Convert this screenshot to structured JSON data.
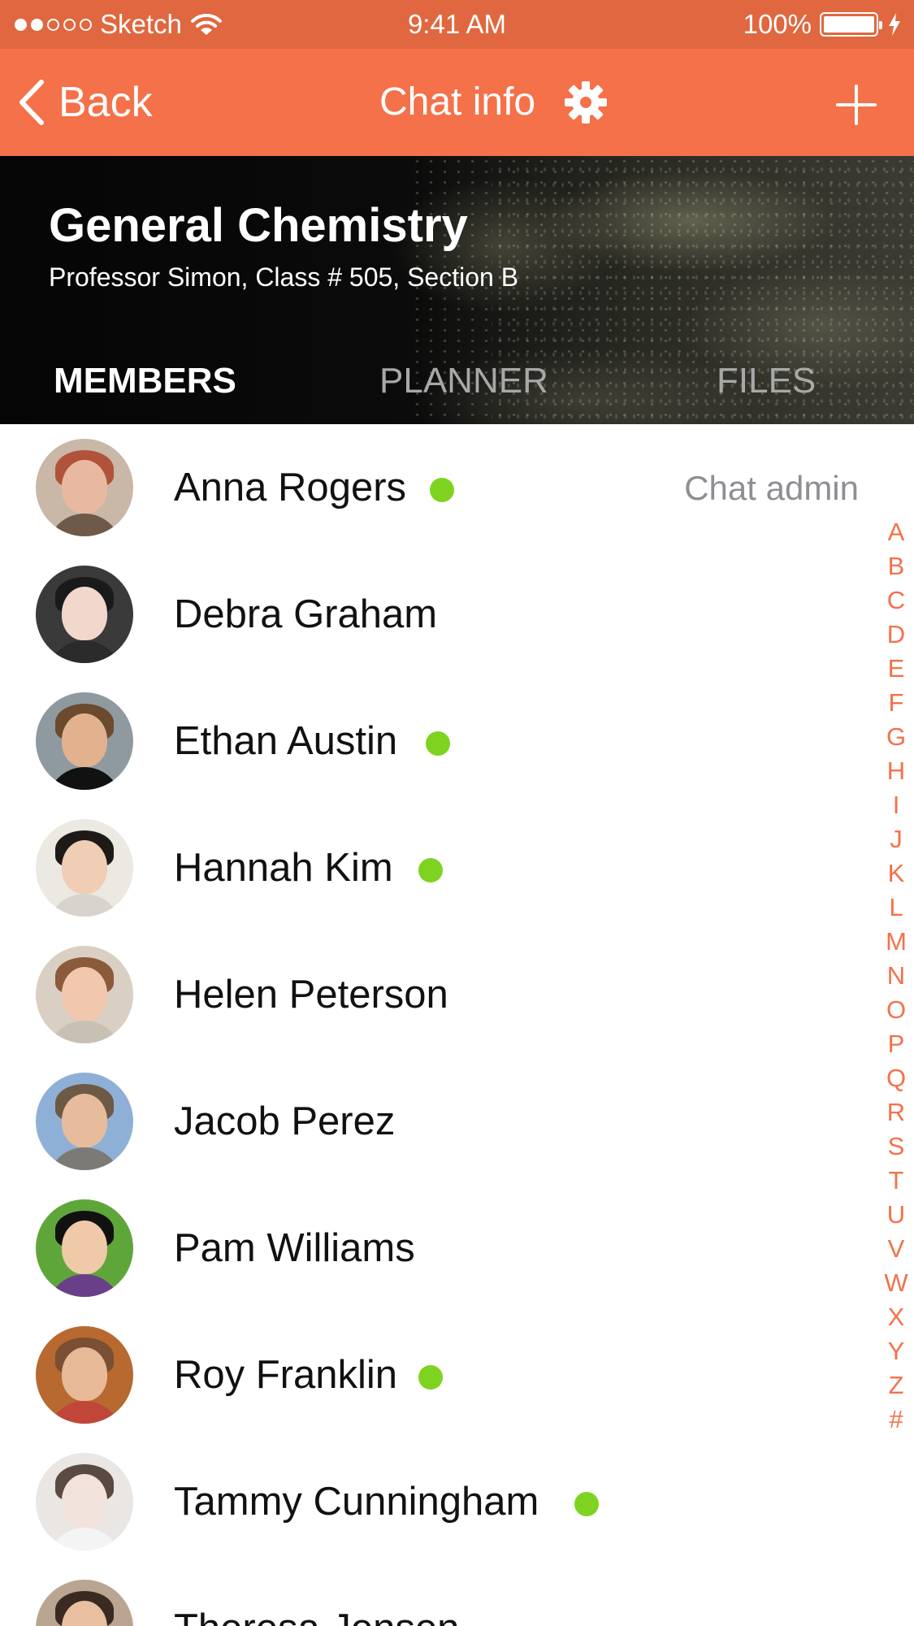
{
  "status_bar": {
    "carrier": "Sketch",
    "time": "9:41 AM",
    "battery": "100%",
    "signal_dots_filled": 2,
    "signal_dots_total": 5
  },
  "nav": {
    "back_label": "Back",
    "title": "Chat info",
    "settings_icon": "gear-icon",
    "add_icon": "plus-icon",
    "color": "#f4714a"
  },
  "header": {
    "title": "General Chemistry",
    "subtitle": "Professor Simon, Class # 505, Section B",
    "tabs": [
      {
        "label": "MEMBERS",
        "active": true
      },
      {
        "label": "PLANNER",
        "active": false
      },
      {
        "label": "FILES",
        "active": false
      }
    ]
  },
  "members": [
    {
      "name": "Anna Rogers",
      "online": true,
      "role": "Chat admin",
      "skin": "#e8b9a0",
      "hair": "#b0533a",
      "shirt": "#6f5a4a",
      "bg": "#c9b7a8"
    },
    {
      "name": "Debra Graham",
      "online": false,
      "role": "",
      "skin": "#f1d7cc",
      "hair": "#1a1a1a",
      "shirt": "#2b2b2b",
      "bg": "#3a3a3a"
    },
    {
      "name": "Ethan Austin",
      "online": true,
      "role": "",
      "skin": "#e2b28f",
      "hair": "#6b4a2e",
      "shirt": "#111111",
      "bg": "#8f9aa0"
    },
    {
      "name": "Hannah Kim",
      "online": true,
      "role": "",
      "skin": "#f0cdb5",
      "hair": "#1e1a17",
      "shirt": "#d8d3cc",
      "bg": "#ece8e2"
    },
    {
      "name": "Helen Peterson",
      "online": false,
      "role": "",
      "skin": "#f1c8ad",
      "hair": "#8a5a3a",
      "shirt": "#c9c0b4",
      "bg": "#d9cfc2"
    },
    {
      "name": "Jacob Perez",
      "online": false,
      "role": "",
      "skin": "#e6bc9c",
      "hair": "#6d5a44",
      "shirt": "#7b7a74",
      "bg": "#8fb0d6"
    },
    {
      "name": "Pam Williams",
      "online": false,
      "role": "",
      "skin": "#f0c9a8",
      "hair": "#111111",
      "shirt": "#6a3f8a",
      "bg": "#5fa63a"
    },
    {
      "name": "Roy Franklin",
      "online": true,
      "role": "",
      "skin": "#e8b997",
      "hair": "#7a4f33",
      "shirt": "#c0463a",
      "bg": "#b7692f"
    },
    {
      "name": "Tammy Cunningham",
      "online": true,
      "role": "",
      "skin": "#f1e3dc",
      "hair": "#5a4a42",
      "shirt": "#f4f4f4",
      "bg": "#e9e6e4"
    },
    {
      "name": "Theresa Jensen",
      "online": false,
      "role": "",
      "skin": "#e8c0a0",
      "hair": "#3a2a22",
      "shirt": "#9a8a7a",
      "bg": "#b9a592"
    }
  ],
  "index_letters": [
    "A",
    "B",
    "C",
    "D",
    "E",
    "F",
    "G",
    "H",
    "I",
    "J",
    "K",
    "L",
    "M",
    "N",
    "O",
    "P",
    "Q",
    "R",
    "S",
    "T",
    "U",
    "V",
    "W",
    "X",
    "Y",
    "Z",
    "#"
  ],
  "online_color": "#7ed321"
}
